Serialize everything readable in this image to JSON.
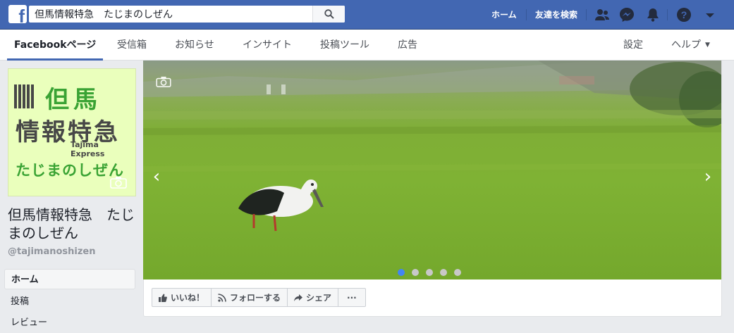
{
  "topbar": {
    "search_value": "但馬情報特急　たじまのしぜん",
    "home_label": "ホーム",
    "find_friends_label": "友達を検索"
  },
  "subnav": {
    "tabs": [
      {
        "label": "Facebookページ",
        "active": true
      },
      {
        "label": "受信箱"
      },
      {
        "label": "お知らせ"
      },
      {
        "label": "インサイト"
      },
      {
        "label": "投稿ツール"
      },
      {
        "label": "広告"
      }
    ],
    "settings_label": "設定",
    "help_label": "ヘルプ"
  },
  "profile": {
    "logo_line1": "但馬",
    "logo_line2": "情報特急",
    "logo_sub": "Tajima Express",
    "logo_line3": "たじまのしぜん",
    "page_name": "但馬情報特急　たじまのしぜん",
    "handle": "@tajimanoshizen"
  },
  "sidebar": {
    "items": [
      {
        "label": "ホーム",
        "active": true
      },
      {
        "label": "投稿"
      },
      {
        "label": "レビュー"
      }
    ]
  },
  "cover": {
    "slides_total": 5,
    "active_slide": 1
  },
  "actions": {
    "like_label": "いいね！",
    "follow_label": "フォローする",
    "share_label": "シェア",
    "more_label": "···"
  },
  "colors": {
    "brand_blue": "#4267b2",
    "accent_green": "#3aa334",
    "dot_active": "#4285f4"
  }
}
